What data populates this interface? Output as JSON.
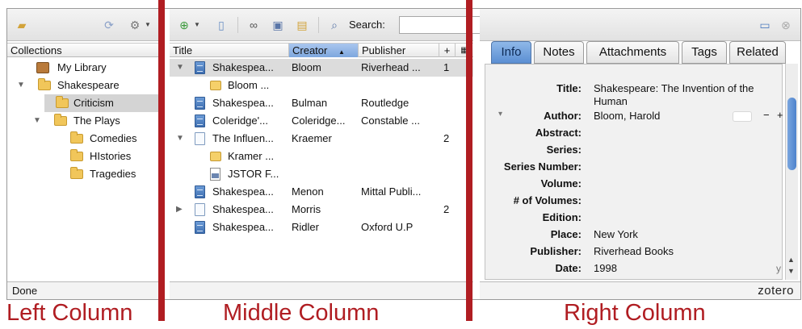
{
  "left": {
    "collections_header": "Collections",
    "items": [
      {
        "label": "My Library",
        "icon": "library-icon"
      },
      {
        "label": "Shakespeare",
        "icon": "folder-icon",
        "twisty": "▼"
      },
      {
        "label": "Criticism",
        "icon": "folder-icon",
        "selected": true
      },
      {
        "label": "The Plays",
        "icon": "folder-icon",
        "twisty": "▼"
      },
      {
        "label": "Comedies",
        "icon": "folder-icon"
      },
      {
        "label": "HIstories",
        "icon": "folder-icon"
      },
      {
        "label": "Tragedies",
        "icon": "folder-icon"
      }
    ],
    "status": "Done"
  },
  "middle": {
    "search_label": "Search:",
    "search_value": "",
    "columns": {
      "title": "Title",
      "creator": "Creator",
      "creator_sort": "▲",
      "publisher": "Publisher",
      "plus": "+"
    },
    "rows": [
      {
        "twisty": "▼",
        "icon": "book",
        "title": "Shakespea...",
        "creator": "Bloom",
        "publisher": "Riverhead ...",
        "count": "1",
        "selected": true
      },
      {
        "icon": "note",
        "title": "Bloom ...",
        "child": true
      },
      {
        "icon": "book",
        "title": "Shakespea...",
        "creator": "Bulman",
        "publisher": "Routledge"
      },
      {
        "icon": "book",
        "title": "Coleridge'...",
        "creator": "Coleridge...",
        "publisher": "Constable ..."
      },
      {
        "twisty": "▼",
        "icon": "page",
        "title": "The Influen...",
        "creator": "Kraemer",
        "count": "2"
      },
      {
        "icon": "note",
        "title": "Kramer ...",
        "child": true
      },
      {
        "icon": "pdf",
        "title": "JSTOR F...",
        "child": true
      },
      {
        "icon": "book",
        "title": "Shakespea...",
        "creator": "Menon",
        "publisher": "Mittal Publi..."
      },
      {
        "twisty": "▶",
        "icon": "page",
        "title": "Shakespea...",
        "creator": "Morris",
        "count": "2"
      },
      {
        "icon": "book",
        "title": "Shakespea...",
        "creator": "Ridler",
        "publisher": "Oxford U.P"
      }
    ]
  },
  "right": {
    "tabs": [
      "Info",
      "Notes",
      "Attachments",
      "Tags",
      "Related"
    ],
    "active_tab": "Info",
    "fields": [
      {
        "label": "Title:",
        "value": "Shakespeare: The Invention of the Human"
      },
      {
        "label": "Author:",
        "value": "Bloom,   Harold"
      },
      {
        "label": "Abstract:",
        "value": ""
      },
      {
        "label": "Series:",
        "value": ""
      },
      {
        "label": "Series Number:",
        "value": ""
      },
      {
        "label": "Volume:",
        "value": ""
      },
      {
        "label": "# of Volumes:",
        "value": ""
      },
      {
        "label": "Edition:",
        "value": ""
      },
      {
        "label": "Place:",
        "value": "New York"
      },
      {
        "label": "Publisher:",
        "value": "Riverhead Books"
      },
      {
        "label": "Date:",
        "value": "1998"
      }
    ],
    "author_minus": "−",
    "author_plus": "+",
    "date_suffix": "y",
    "author_twisty": "▾",
    "brand": "zotero"
  },
  "captions": {
    "left": "Left Column",
    "middle": "Middle Column",
    "right": "Right Column"
  },
  "colors": {
    "accent_divider": "#b01d22",
    "selected_tab": "#5b8fd3",
    "selection": "#dcdcdc"
  }
}
